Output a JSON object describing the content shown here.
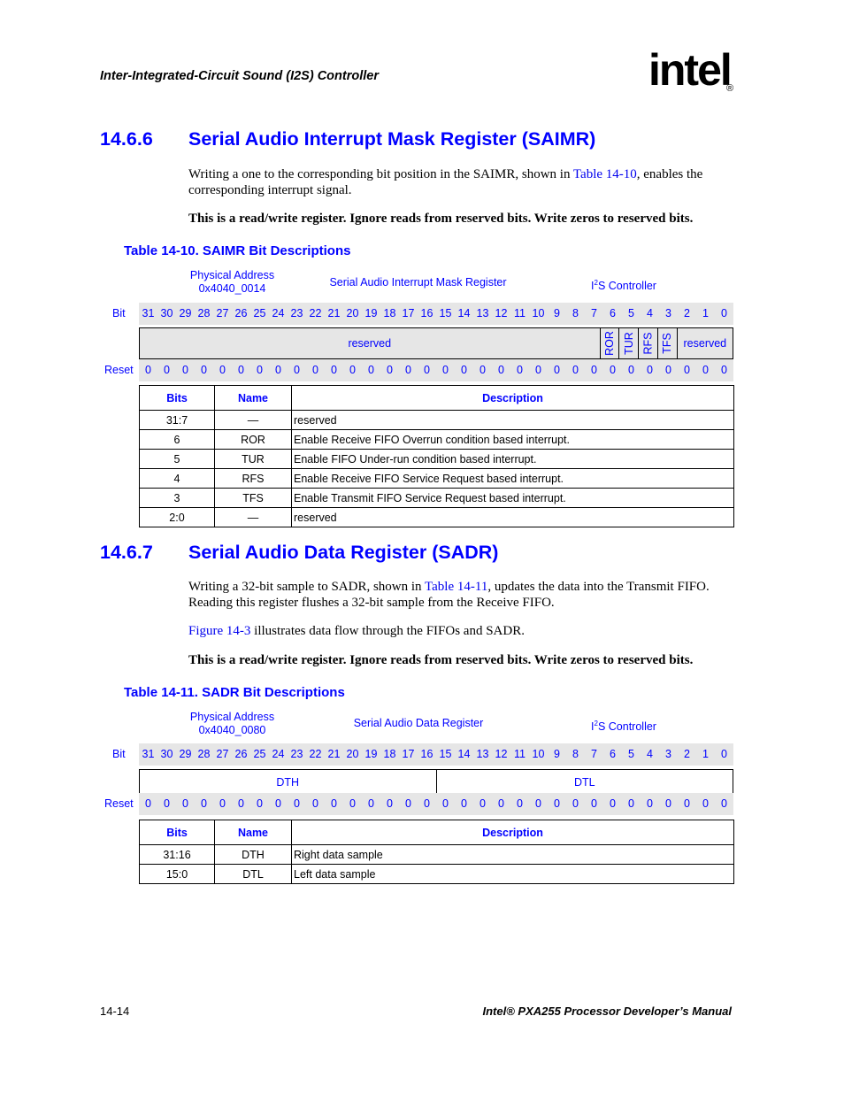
{
  "header": {
    "title": "Inter-Integrated-Circuit Sound (I2S) Controller",
    "logo_text": "intel",
    "logo_reg": "®"
  },
  "sections": [
    {
      "number": "14.6.6",
      "title": "Serial Audio Interrupt Mask Register (SAIMR)",
      "para1_pre": "Writing a one to the corresponding bit position in the SAIMR, shown in ",
      "para1_link": "Table 14-10",
      "para1_post": ", enables the corresponding interrupt signal.",
      "note": "This is a read/write register. Ignore reads from reserved bits. Write zeros to reserved bits.",
      "table_caption": "Table 14-10. SAIMR Bit Descriptions",
      "register": {
        "addr_label": "Physical Address",
        "addr_value": "0x4040_0014",
        "name": "Serial Audio Interrupt Mask Register",
        "unit_sup": "2",
        "unit_pre": "I",
        "unit_post": "S Controller",
        "bit_label": "Bit",
        "reset_label": "Reset",
        "bits": [
          "31",
          "30",
          "29",
          "28",
          "27",
          "26",
          "25",
          "24",
          "23",
          "22",
          "21",
          "20",
          "19",
          "18",
          "17",
          "16",
          "15",
          "14",
          "13",
          "12",
          "11",
          "10",
          "9",
          "8",
          "7",
          "6",
          "5",
          "4",
          "3",
          "2",
          "1",
          "0"
        ],
        "reset": [
          "0",
          "0",
          "0",
          "0",
          "0",
          "0",
          "0",
          "0",
          "0",
          "0",
          "0",
          "0",
          "0",
          "0",
          "0",
          "0",
          "0",
          "0",
          "0",
          "0",
          "0",
          "0",
          "0",
          "0",
          "0",
          "0",
          "0",
          "0",
          "0",
          "0",
          "0",
          "0"
        ],
        "fields": [
          {
            "label": "reserved",
            "span": 25,
            "vertical": false
          },
          {
            "label": "ROR",
            "span": 1,
            "vertical": true
          },
          {
            "label": "TUR",
            "span": 1,
            "vertical": true
          },
          {
            "label": "RFS",
            "span": 1,
            "vertical": true
          },
          {
            "label": "TFS",
            "span": 1,
            "vertical": true
          },
          {
            "label": "reserved",
            "span": 3,
            "vertical": false
          }
        ]
      },
      "desc_table": {
        "headers": [
          "Bits",
          "Name",
          "Description"
        ],
        "rows": [
          {
            "bits": "31:7",
            "name": "—",
            "desc": "reserved"
          },
          {
            "bits": "6",
            "name": "ROR",
            "desc": "Enable Receive FIFO Overrun condition based interrupt."
          },
          {
            "bits": "5",
            "name": "TUR",
            "desc": "Enable FIFO Under-run condition based interrupt."
          },
          {
            "bits": "4",
            "name": "RFS",
            "desc": "Enable Receive FIFO Service Request based interrupt."
          },
          {
            "bits": "3",
            "name": "TFS",
            "desc": "Enable Transmit FIFO Service Request based interrupt."
          },
          {
            "bits": "2:0",
            "name": "—",
            "desc": "reserved"
          }
        ]
      }
    },
    {
      "number": "14.6.7",
      "title": "Serial Audio Data Register (SADR)",
      "para1_pre": "Writing a 32-bit sample to SADR, shown in ",
      "para1_link": "Table 14-11",
      "para1_post": ", updates the data into the Transmit FIFO. Reading this register flushes a 32-bit sample from the Receive FIFO.",
      "para2_link": "Figure 14-3",
      "para2_post": " illustrates data flow through the FIFOs and SADR.",
      "note": "This is a read/write register. Ignore reads from reserved bits. Write zeros to reserved bits.",
      "table_caption": "Table 14-11. SADR Bit Descriptions",
      "register": {
        "addr_label": "Physical Address",
        "addr_value": "0x4040_0080",
        "name": "Serial Audio Data Register",
        "unit_sup": "2",
        "unit_pre": "I",
        "unit_post": "S Controller",
        "bit_label": "Bit",
        "reset_label": "Reset",
        "bits": [
          "31",
          "30",
          "29",
          "28",
          "27",
          "26",
          "25",
          "24",
          "23",
          "22",
          "21",
          "20",
          "19",
          "18",
          "17",
          "16",
          "15",
          "14",
          "13",
          "12",
          "11",
          "10",
          "9",
          "8",
          "7",
          "6",
          "5",
          "4",
          "3",
          "2",
          "1",
          "0"
        ],
        "reset": [
          "0",
          "0",
          "0",
          "0",
          "0",
          "0",
          "0",
          "0",
          "0",
          "0",
          "0",
          "0",
          "0",
          "0",
          "0",
          "0",
          "0",
          "0",
          "0",
          "0",
          "0",
          "0",
          "0",
          "0",
          "0",
          "0",
          "0",
          "0",
          "0",
          "0",
          "0",
          "0"
        ],
        "fields": [
          {
            "label": "DTH",
            "span": 16,
            "vertical": false
          },
          {
            "label": "DTL",
            "span": 16,
            "vertical": false
          }
        ]
      },
      "desc_table": {
        "headers": [
          "Bits",
          "Name",
          "Description"
        ],
        "rows": [
          {
            "bits": "31:16",
            "name": "DTH",
            "desc": "Right data sample"
          },
          {
            "bits": "15:0",
            "name": "DTL",
            "desc": "Left data sample"
          }
        ]
      }
    }
  ],
  "footer": {
    "page": "14-14",
    "manual": "Intel® PXA255 Processor Developer’s Manual"
  }
}
